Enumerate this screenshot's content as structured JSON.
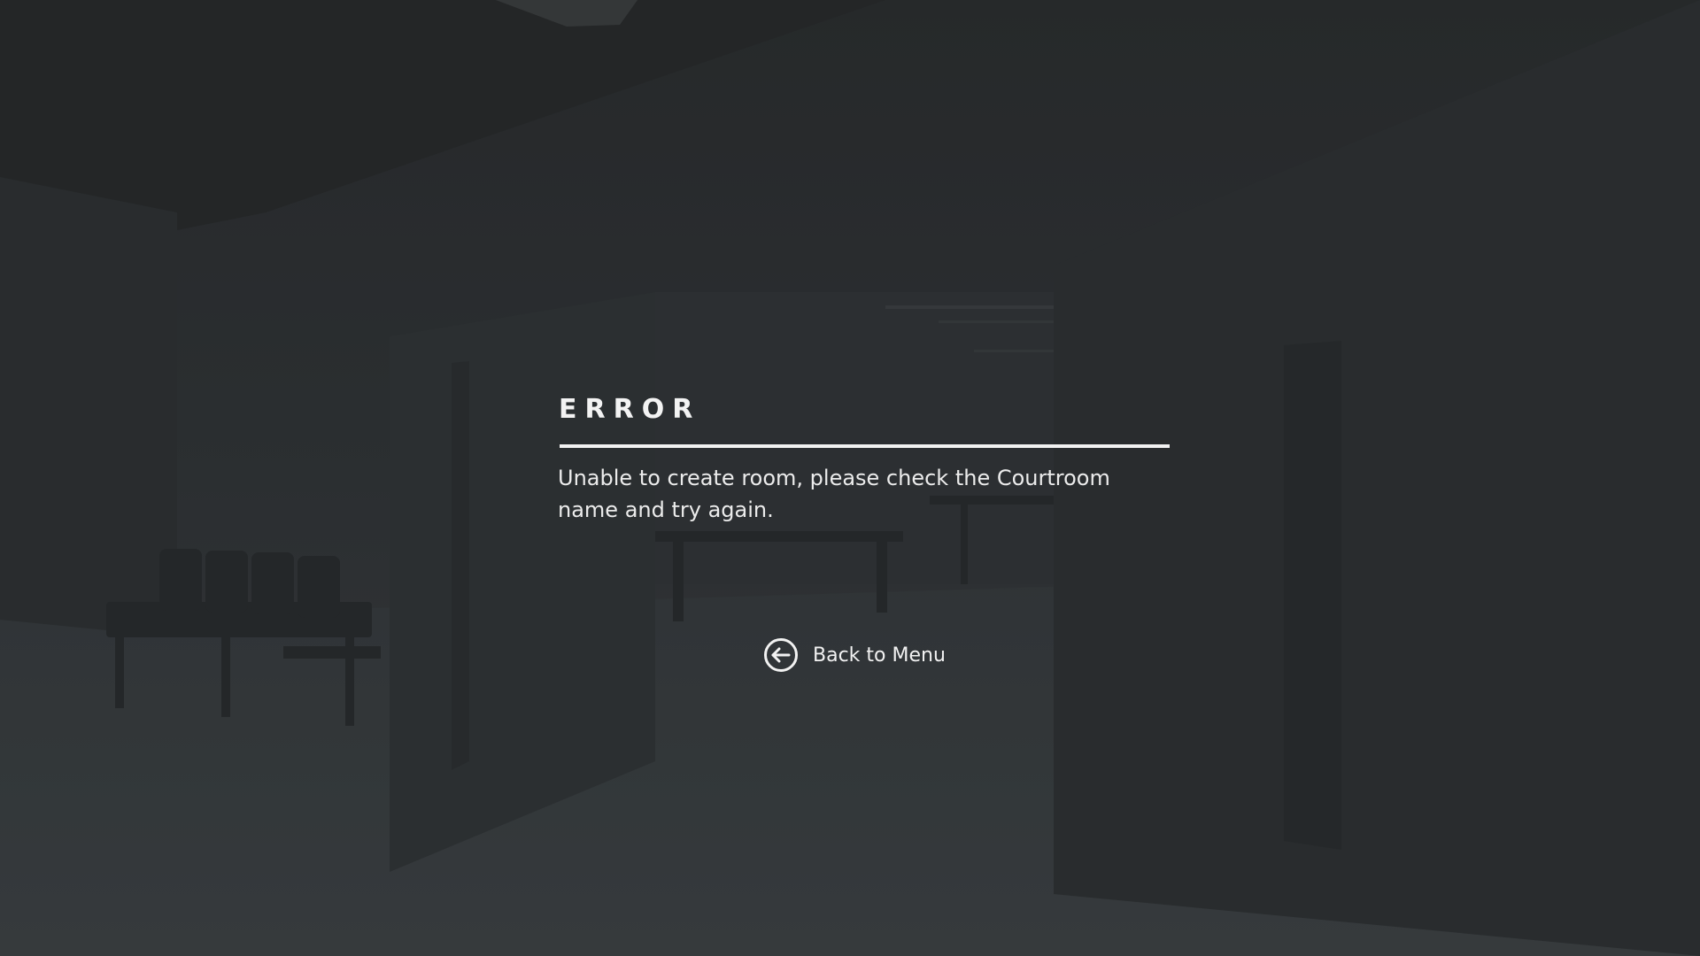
{
  "dialog": {
    "title": "ERROR",
    "message": "Unable to create room, please check the Courtroom name and try again."
  },
  "actions": {
    "back_label": "Back to Menu",
    "back_icon": "arrow-left-circle-icon"
  },
  "colors": {
    "background": "#2e3134",
    "text": "#f2f2f2",
    "rule": "#f2f2f2"
  }
}
